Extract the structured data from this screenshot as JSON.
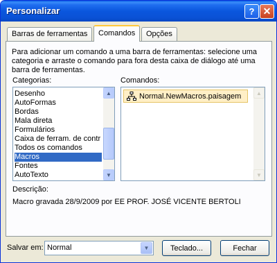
{
  "window": {
    "title": "Personalizar"
  },
  "titlebar": {
    "help_label": "?",
    "close_label": "✕"
  },
  "tabs": [
    {
      "label": "Barras de ferramentas"
    },
    {
      "label": "Comandos"
    },
    {
      "label": "Opções"
    }
  ],
  "instructions": "Para adicionar um comando a uma barra de ferramentas: selecione uma categoria e arraste o comando para fora desta caixa de diálogo até uma barra de ferramentas.",
  "categories": {
    "label": "Categorias:",
    "items": [
      "Desenho",
      "AutoFormas",
      "Bordas",
      "Mala direta",
      "Formulários",
      "Caixa de ferram. de contr",
      "Todos os comandos",
      "Macros",
      "Fontes",
      "AutoTexto"
    ],
    "selected": "Macros"
  },
  "commands": {
    "label": "Comandos:",
    "items": [
      {
        "label": "Normal.NewMacros.paisagem",
        "icon": "macro-icon"
      }
    ]
  },
  "description": {
    "label": "Descrição:",
    "text": "Macro gravada 28/9/2009 por EE PROF. JOSÉ VICENTE BERTOLI"
  },
  "footer": {
    "save_label": "Salvar em:",
    "save_value": "Normal",
    "keyboard_button": "Teclado...",
    "close_button": "Fechar"
  },
  "colors": {
    "titlebar": "#0a56dd",
    "selection": "#316ac5",
    "highlight": "#ffefc6",
    "dialog_bg": "#ece9d8"
  }
}
